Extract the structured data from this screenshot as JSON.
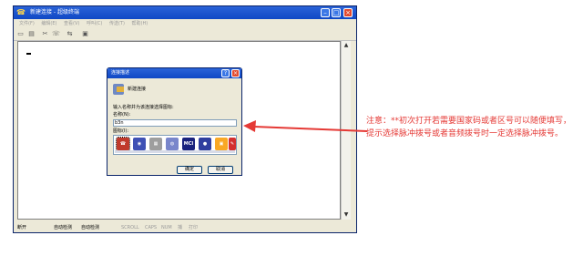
{
  "window": {
    "title": "新建连接 - 超级终端",
    "colors": {
      "titlebar": "#0f48c5",
      "face": "#ece9d8"
    }
  },
  "menu": [
    "文件(F)",
    "编辑(E)",
    "查看(V)",
    "呼叫(C)",
    "传送(T)",
    "帮助(H)"
  ],
  "toolbar_icons": [
    "new-icon",
    "open-icon",
    "disconnect-icon",
    "phone-icon",
    "send-icon",
    "properties-icon"
  ],
  "status": {
    "connection": "断开",
    "detect1": "自动检测",
    "detect2": "自动检测",
    "scroll": "SCROLL",
    "caps": "CAPS",
    "num": "NUM",
    "capture": "捕",
    "print": "打印"
  },
  "dialog": {
    "title": "连接描述",
    "header": "新建连接",
    "prompt": "输入名称并为该连接选择图标:",
    "name_label": "名称(N):",
    "name_value": "b3n",
    "icon_label": "图标(I):",
    "ok": "确定",
    "cancel": "取消"
  },
  "note": {
    "text": "注意：**初次打开若需要国家码或者区号可以随便填写，提示选择脉冲拨号或者音频拨号时一定选择脉冲拨号。",
    "color": "#e53935"
  }
}
